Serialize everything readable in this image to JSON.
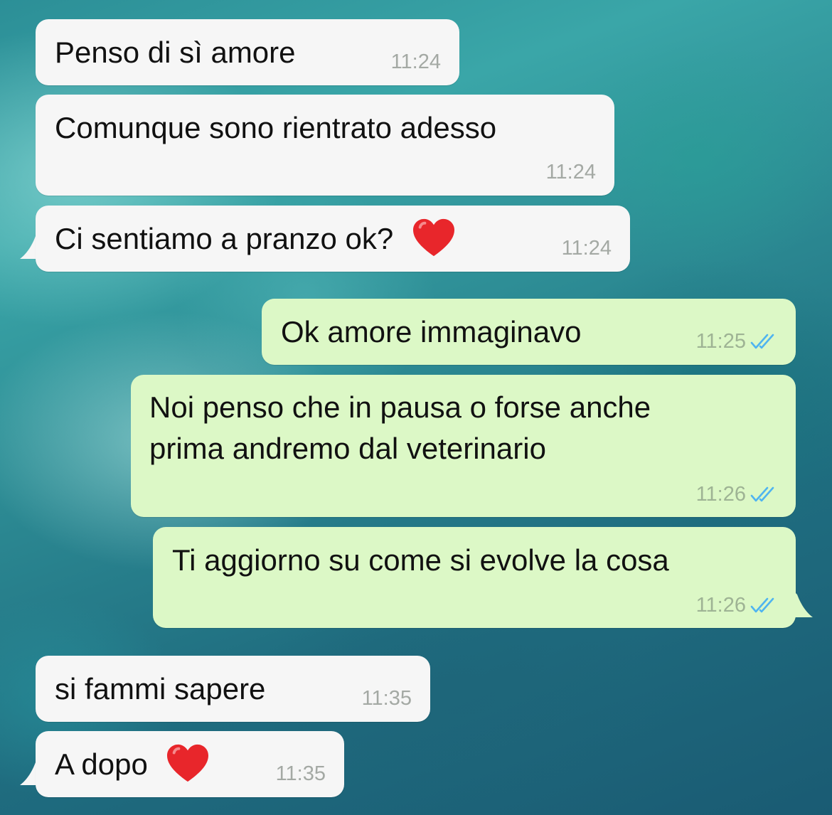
{
  "conversation": {
    "messages": [
      {
        "direction": "incoming",
        "text": "Penso di sì amore",
        "time": "11:24"
      },
      {
        "direction": "incoming",
        "text": "Comunque sono rientrato adesso",
        "time": "11:24"
      },
      {
        "direction": "incoming",
        "text": "Ci sentiamo a pranzo ok?",
        "emoji": "red-heart",
        "time": "11:24"
      },
      {
        "direction": "outgoing",
        "text": "Ok amore immaginavo",
        "time": "11:25",
        "status": "read"
      },
      {
        "direction": "outgoing",
        "text_lines": [
          "Noi penso che in pausa o forse anche",
          "prima andremo dal veterinario"
        ],
        "time": "11:26",
        "status": "read"
      },
      {
        "direction": "outgoing",
        "text": "Ti aggiorno su come si evolve la cosa",
        "time": "11:26",
        "status": "read"
      },
      {
        "direction": "incoming",
        "text": "si fammi sapere",
        "time": "11:35"
      },
      {
        "direction": "incoming",
        "text": "A dopo",
        "emoji": "red-heart",
        "time": "11:35"
      }
    ]
  },
  "colors": {
    "incoming_bubble": "#f6f6f6",
    "outgoing_bubble": "#dcf8c6",
    "read_ticks": "#4fb4f0",
    "heart": "#e8262b"
  }
}
